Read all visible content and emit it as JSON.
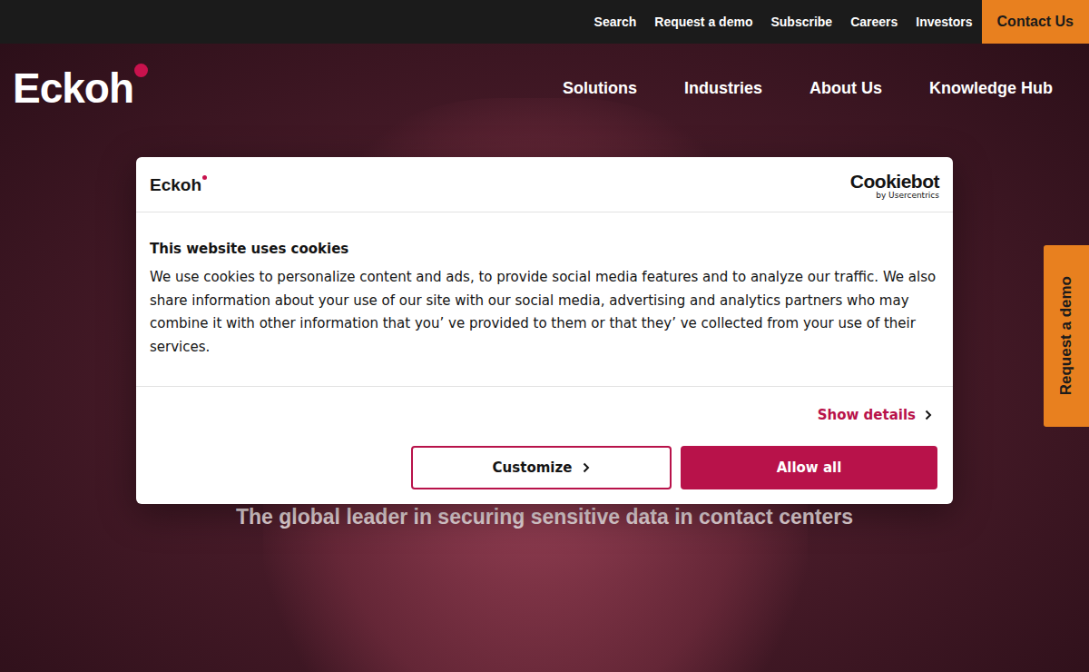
{
  "top_bar": {
    "links": [
      "Search",
      "Request a demo",
      "Subscribe",
      "Careers",
      "Investors"
    ],
    "contact_button": "Contact Us"
  },
  "header": {
    "logo": "Eckoh",
    "nav": [
      "Solutions",
      "Industries",
      "About Us",
      "Knowledge Hub"
    ]
  },
  "hero": {
    "subtitle": "The global leader in securing sensitive data in contact centers"
  },
  "side_tab": "Request a demo",
  "cookie_dialog": {
    "logo": "Eckoh",
    "brand": "Cookiebot",
    "brand_sub": "by Usercentrics",
    "title": "This website uses cookies",
    "body": "We use cookies to personalize content and ads, to provide social media features and to analyze our traffic. We also share information about your use of our site with our social media, advertising and analytics partners who may combine it with other information that you’  ve provided to them or that they’  ve collected from your use of their services.",
    "show_details": "Show details",
    "buttons": [
      {
        "label": "Customize",
        "kind": "outline"
      },
      {
        "label": "Allow all",
        "kind": "filled"
      }
    ]
  }
}
